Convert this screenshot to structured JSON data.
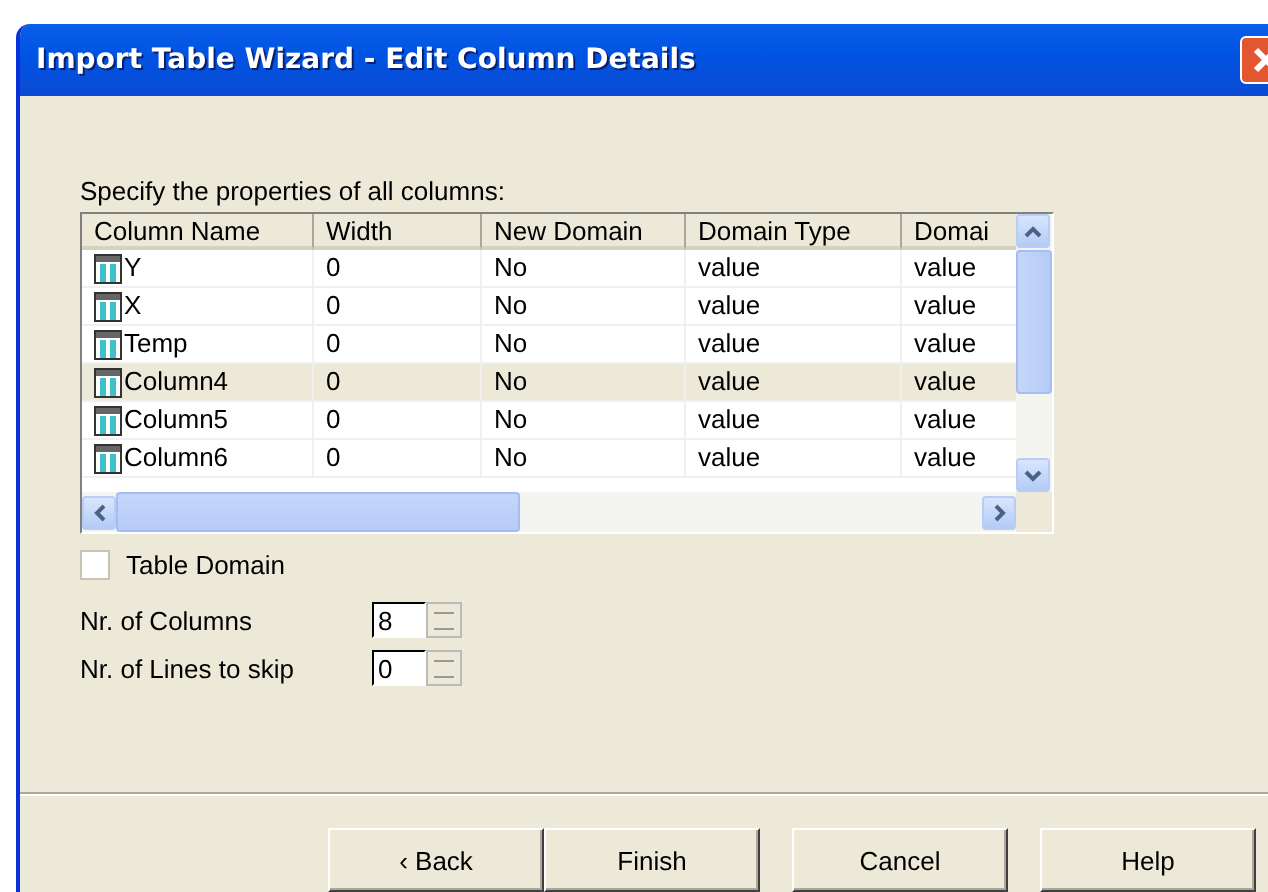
{
  "window": {
    "title": "Import Table Wizard - Edit Column Details"
  },
  "instruction": "Specify the properties of all columns:",
  "table": {
    "columns": [
      "Column Name",
      "Width",
      "New Domain",
      "Domain Type",
      "Domai"
    ],
    "rows": [
      {
        "cells": [
          "Y",
          "0",
          "No",
          "value",
          "value"
        ],
        "selected": false
      },
      {
        "cells": [
          "X",
          "0",
          "No",
          "value",
          "value"
        ],
        "selected": false
      },
      {
        "cells": [
          "Temp",
          "0",
          "No",
          "value",
          "value"
        ],
        "selected": false
      },
      {
        "cells": [
          "Column4",
          "0",
          "No",
          "value",
          "value"
        ],
        "selected": true
      },
      {
        "cells": [
          "Column5",
          "0",
          "No",
          "value",
          "value"
        ],
        "selected": false
      },
      {
        "cells": [
          "Column6",
          "0",
          "No",
          "value",
          "value"
        ],
        "selected": false
      }
    ]
  },
  "table_domain": {
    "label": "Table Domain",
    "checked": false
  },
  "fields": [
    {
      "label": "Nr. of Columns",
      "value": "8"
    },
    {
      "label": "Nr. of Lines to skip",
      "value": "0"
    }
  ],
  "buttons": [
    {
      "label": "‹ Back",
      "kind": "joined"
    },
    {
      "label": "Finish",
      "kind": "joined"
    },
    {
      "label": "Cancel",
      "kind": "single"
    },
    {
      "label": "Help",
      "kind": "single"
    }
  ]
}
